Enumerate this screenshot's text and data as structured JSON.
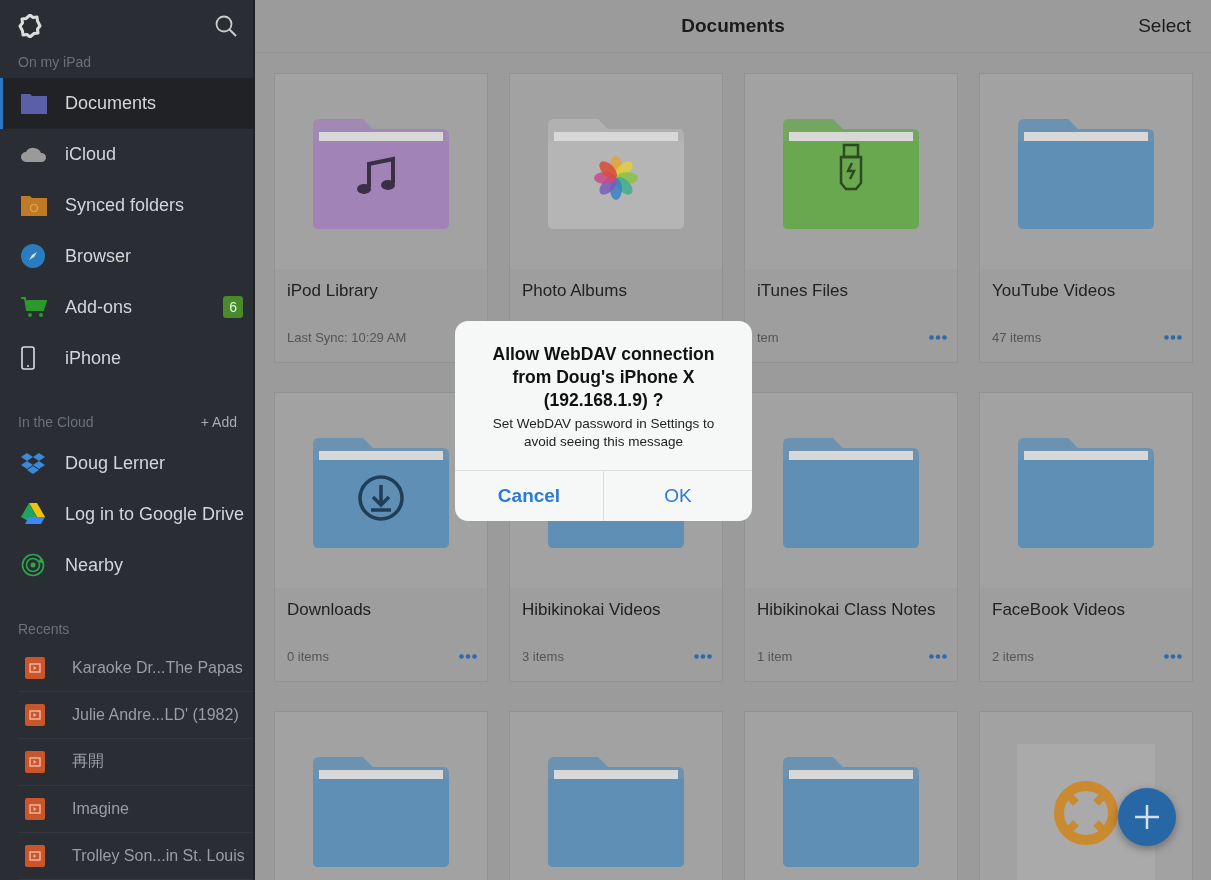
{
  "sidebar": {
    "sections": [
      {
        "title": "On my iPad",
        "items": [
          {
            "label": "Documents",
            "kind": "folder",
            "selected": true
          },
          {
            "label": "iCloud",
            "kind": "cloud",
            "selected": false
          },
          {
            "label": "Synced folders",
            "kind": "synced",
            "selected": false
          },
          {
            "label": "Browser",
            "kind": "compass",
            "selected": false
          },
          {
            "label": "Add-ons",
            "kind": "cart",
            "selected": false,
            "badge": "6"
          },
          {
            "label": "iPhone",
            "kind": "phone",
            "selected": false
          }
        ]
      },
      {
        "title": "In the Cloud",
        "action": "+ Add",
        "items": [
          {
            "label": "Doug Lerner",
            "kind": "dropbox",
            "selected": false
          },
          {
            "label": "Log in to Google Drive",
            "kind": "drive",
            "selected": false
          },
          {
            "label": "Nearby",
            "kind": "radar",
            "selected": false
          }
        ]
      }
    ],
    "recents_title": "Recents",
    "recents": [
      "Karaoke Dr...The Papas",
      "Julie Andre...LD' (1982)",
      "再開",
      "Imagine",
      "Trolley Son...in St. Louis"
    ]
  },
  "header": {
    "title": "Documents",
    "action": "Select"
  },
  "folders": [
    {
      "title": "iPod Library",
      "subtitle": "Last Sync: 10:29 AM",
      "kind": "music",
      "color": "#a283b8",
      "more": false
    },
    {
      "title": "Photo Albums",
      "kind": "photos",
      "color": "#b5b5b5",
      "more": false
    },
    {
      "title": "iTunes Files",
      "subtitle": "tem",
      "kind": "usb",
      "color": "#6aa84f",
      "more": true
    },
    {
      "title": "YouTube Videos",
      "subtitle": "47 items",
      "kind": "plain",
      "color": "#5f8fb5",
      "more": true
    },
    {
      "title": "Downloads",
      "subtitle": "0 items",
      "kind": "download",
      "color": "#5f8fb5",
      "more": true
    },
    {
      "title": "Hibikinokai Videos",
      "subtitle": "3 items",
      "kind": "plain",
      "color": "#5f8fb5",
      "more": true
    },
    {
      "title": "Hibikinokai Class Notes",
      "subtitle": "1 item",
      "kind": "plain",
      "color": "#5f8fb5",
      "more": true
    },
    {
      "title": "FaceBook Videos",
      "subtitle": "2 items",
      "kind": "plain",
      "color": "#5f8fb5",
      "more": true
    },
    {
      "kind": "plain",
      "color": "#5f8fb5",
      "more": false
    },
    {
      "kind": "plain",
      "color": "#5f8fb5",
      "more": false
    },
    {
      "kind": "plain",
      "color": "#5f8fb5",
      "more": false
    },
    {
      "kind": "help",
      "color": "#c98a30",
      "more": false
    }
  ],
  "dialog": {
    "title": "Allow WebDAV connection\nfrom Doug's iPhone X\n(192.168.1.9) ?",
    "message": "Set WebDAV password in Settings to\navoid seeing this message",
    "buttons": [
      {
        "label": "Cancel",
        "bold": true
      },
      {
        "label": "OK",
        "bold": false
      }
    ]
  }
}
